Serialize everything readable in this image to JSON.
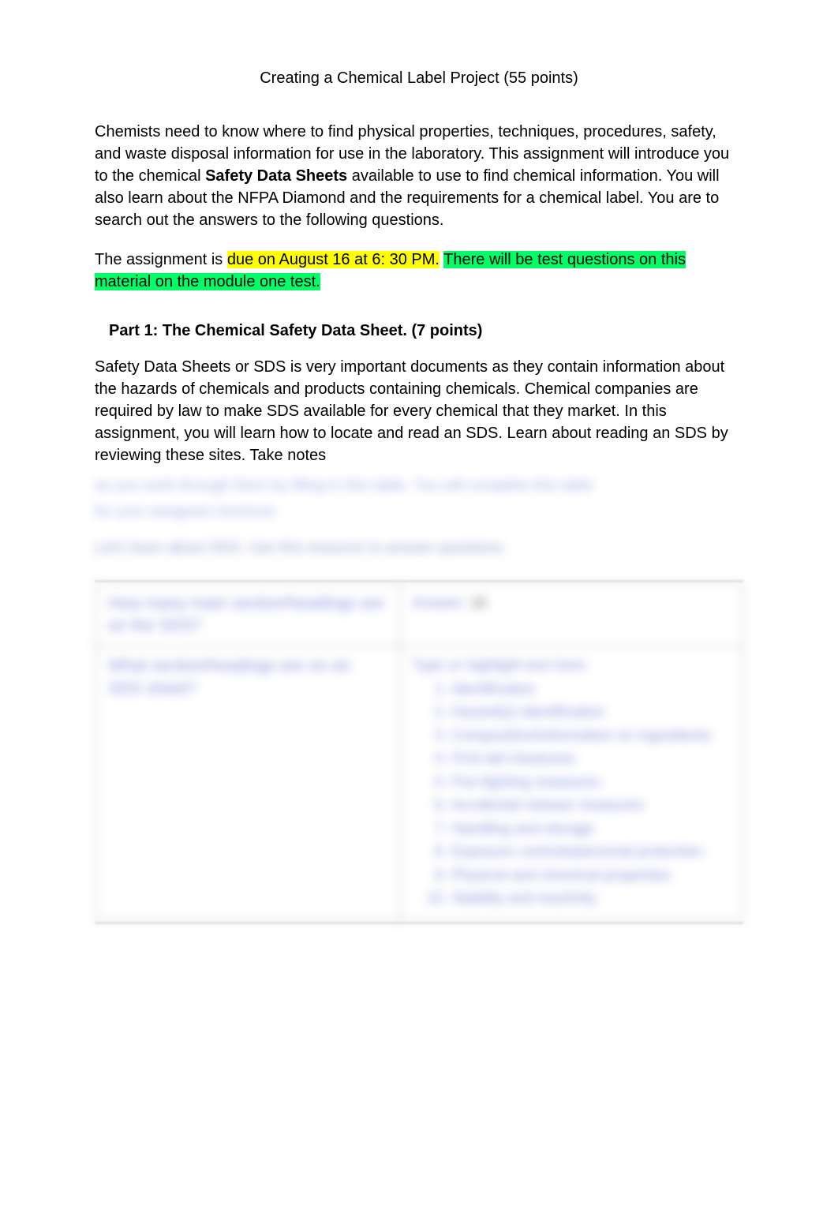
{
  "title": "Creating a Chemical Label Project (55 points)",
  "intro": {
    "p1_a": "Chemists need to know where to find physical properties, techniques, procedures, safety, and waste disposal information for use in the laboratory.  This assignment will introduce you to the chemical ",
    "p1_bold": "Safety Data Sheets",
    "p1_b": " available to use to find chemical information.  You will also learn about the NFPA Diamond and the requirements for a chemical label. You are to search out the answers to the following questions."
  },
  "due": {
    "prefix": "The assignment is ",
    "yellow": "due on August 16 at 6: 30 PM.",
    "gap": "   ",
    "green": "There will be test questions on this material on the module one test."
  },
  "part1": {
    "heading": "Part 1: The Chemical Safety Data Sheet. (7 points)",
    "body": "Safety Data Sheets or SDS is very important documents as they contain information about the hazards of chemicals and products containing chemicals.  Chemical companies are required by law to make SDS available for every chemical that they market.  In this assignment, you will learn how to locate and read an SDS.  Learn about reading an SDS by reviewing these sites. Take notes"
  },
  "obscured": {
    "line1": "as you work through them by filling in this table.        You will complete this table",
    "line2": "for your assigned chemical.",
    "line3": "Let's learn about SDS. Use this resource to answer questions."
  },
  "table": {
    "r1": {
      "q": "How many main section/headings are on the SDS?",
      "a_label": "Answer:",
      "a_val": "16"
    },
    "r2": {
      "q": "What section/headings are on an SDS sheet?",
      "a_lead": "Type or highlight text here:",
      "items": [
        "Identification",
        "Hazard(s) identification",
        "Composition/information on ingredients",
        "First-aid measures",
        "Fire-fighting measures",
        "Accidental release measures",
        "Handling and storage",
        "Exposure controls/personal protection",
        "Physical and chemical properties",
        "Stability and reactivity"
      ]
    }
  }
}
